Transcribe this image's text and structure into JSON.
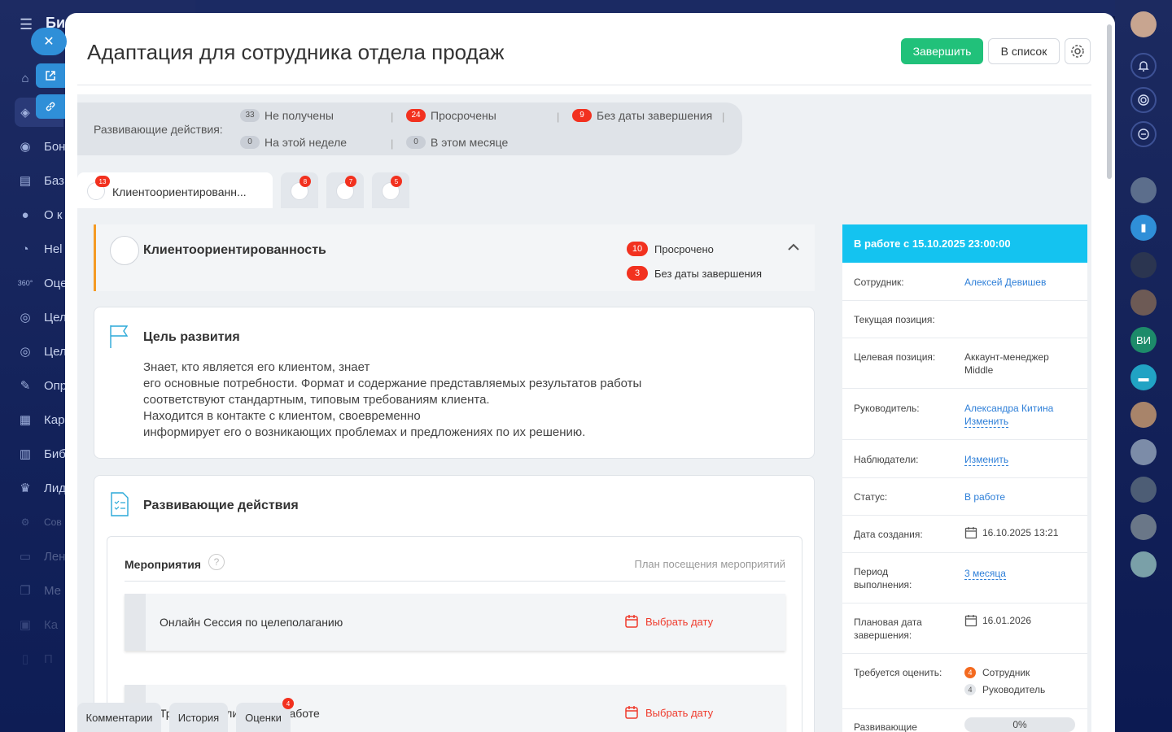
{
  "left_nav": {
    "title": "Би",
    "items": [
      {
        "label": "",
        "icon": "home-icon"
      },
      {
        "label": "",
        "icon": "layers-icon"
      },
      {
        "label": "Бон",
        "icon": "gamepad-icon"
      },
      {
        "label": "Баз",
        "icon": "book-icon"
      },
      {
        "label": "О к",
        "icon": "lock-icon"
      },
      {
        "label": "Hel",
        "icon": "help-icon"
      },
      {
        "label": "Оце",
        "icon": "360-icon"
      },
      {
        "label": "Цел",
        "icon": "target-icon"
      },
      {
        "label": "Цел",
        "icon": "target-icon"
      },
      {
        "label": "Опр",
        "icon": "survey-icon"
      },
      {
        "label": "Кар",
        "icon": "career-icon"
      },
      {
        "label": "Биб",
        "icon": "library-icon"
      },
      {
        "label": "Лид",
        "icon": "trophy-icon"
      },
      {
        "label": "Сов",
        "icon": "gear-icon"
      },
      {
        "label": "Лен",
        "icon": "feed-icon"
      },
      {
        "label": "Ме",
        "icon": "copy-icon"
      },
      {
        "label": "Ка",
        "icon": "calendar-icon"
      },
      {
        "label": "П",
        "icon": "doc-icon"
      }
    ]
  },
  "header": {
    "title": "Адаптация для сотрудника отдела продаж",
    "finish_label": "Завершить",
    "list_label": "В список"
  },
  "stats": {
    "label": "Развивающие действия:",
    "items": [
      {
        "count": "33",
        "label": "Не получены"
      },
      {
        "count": "24",
        "label": "Просрочены"
      },
      {
        "count": "9",
        "label": "Без даты завершения"
      },
      {
        "count": "0",
        "label": "На этой неделе"
      },
      {
        "count": "0",
        "label": "В этом месяце"
      }
    ]
  },
  "tabs": [
    {
      "label": "Клиентоориентированн...",
      "badge": "13"
    },
    {
      "label": "",
      "badge": "8"
    },
    {
      "label": "",
      "badge": "7"
    },
    {
      "label": "",
      "badge": "5"
    }
  ],
  "competency": {
    "title": "Клиентоориентированность",
    "overdue_count": "10",
    "overdue_label": "Просрочено",
    "nodate_count": "3",
    "nodate_label": "Без даты завершения"
  },
  "goal": {
    "title": "Цель развития",
    "lines": [
      "Знает, кто является его клиентом, знает",
      "его основные потребности. Формат и содержание представляемых результатов работы",
      "соответствуют стандартным, типовым требованиям клиента.",
      "Находится в контакте с клиентом, своевременно",
      "информирует его о возникающих проблемах и предложениях по их решению."
    ]
  },
  "actions": {
    "title": "Развивающие действия",
    "events_title": "Мероприятия",
    "plan_link": "План посещения мероприятий",
    "events": [
      {
        "name": "Онлайн Сессия по целеполаганию",
        "pick": "Выбрать дату"
      },
      {
        "name": "Тренинг по клиентской работе",
        "pick": "Выбрать дату"
      }
    ]
  },
  "info": {
    "header": "В работе с 15.10.2025 23:00:00",
    "employee_label": "Сотрудник:",
    "employee_value": "Алексей Девишев",
    "current_pos_label": "Текущая позиция:",
    "target_pos_label": "Целевая позиция:",
    "target_pos_value": "Аккаунт-менеджер",
    "target_pos_value2": "Middle",
    "manager_label": "Руководитель:",
    "manager_value": "Александра Китина",
    "change_label": "Изменить",
    "observers_label": "Наблюдатели:",
    "status_label": "Статус:",
    "status_value": "В работе",
    "created_label": "Дата создания:",
    "created_value": "16.10.2025 13:21",
    "period_label_1": "Период",
    "period_label_2": "выполнения:",
    "period_value": "3 месяца",
    "planned_label_1": "Плановая дата",
    "planned_label_2": "завершения:",
    "planned_value": "16.01.2026",
    "rate_label": "Требуется оценить:",
    "rate_employee_count": "4",
    "rate_employee": "Сотрудник",
    "rate_manager_count": "4",
    "rate_manager": "Руководитель",
    "dev_label": "Развивающие",
    "dev_progress": "0%"
  },
  "bottom_tabs": {
    "comments": "Комментарии",
    "history": "История",
    "ratings": "Оценки",
    "ratings_badge": "4"
  },
  "right_rail": {
    "initials": "ВИ"
  },
  "colors": {
    "accent_green": "#21c17a",
    "badge_red": "#f2311f",
    "info_header": "#14c3f0",
    "link": "#2e7fd8",
    "orange": "#f59a23"
  }
}
